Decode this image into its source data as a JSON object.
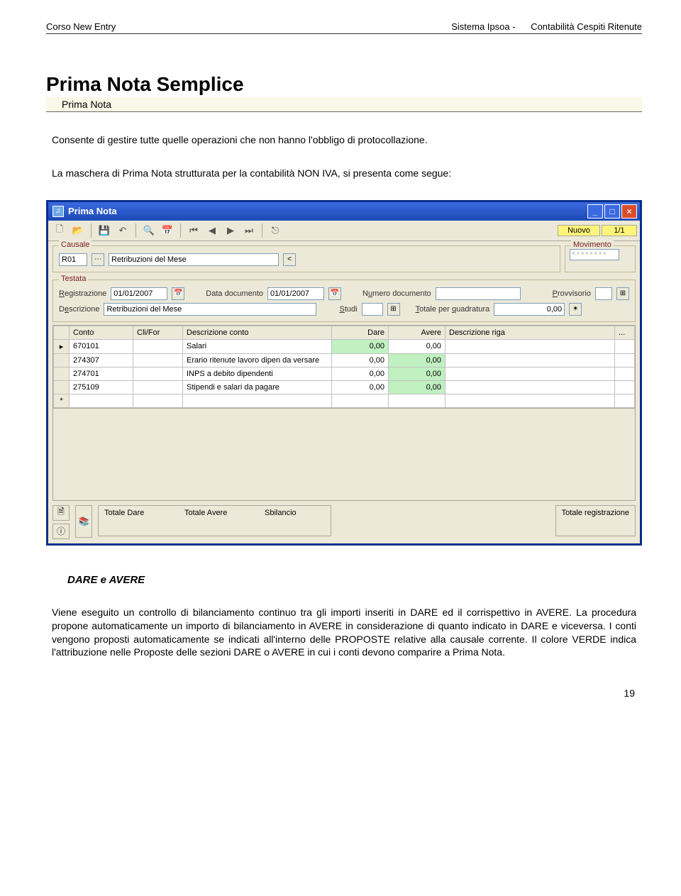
{
  "header": {
    "left": "Corso New Entry",
    "right_a": "Sistema Ipsoa -",
    "right_b": "Contabilità Cespiti Ritenute"
  },
  "title": "Prima Nota Semplice",
  "subtitle": "Prima Nota",
  "intro": "Consente di gestire tutte quelle operazioni che non hanno l'obbligo di protocollazione.",
  "lead_in": "La maschera di Prima Nota strutturata per la contabilità NON IVA, si presenta come segue:",
  "window": {
    "title": "Prima Nota",
    "status_new": "Nuovo",
    "status_count": "1/1",
    "causale": {
      "group": "Causale",
      "code": "R01",
      "desc": "Retribuzioni del Mese"
    },
    "movimento": {
      "group": "Movimento",
      "mask": "××××××××"
    },
    "testata": {
      "group": "Testata",
      "reg_label": "Registrazione",
      "reg_value": "01/01/2007",
      "doc_label": "Data documento",
      "doc_value": "01/01/2007",
      "num_label": "Numero documento",
      "num_value": "",
      "prov_label": "Provvisorio",
      "desc_label": "Descrizione",
      "desc_value": "Retribuzioni del Mese",
      "studi_label": "Studi",
      "tot_label": "Totale per quadratura",
      "tot_value": "0,00"
    },
    "grid": {
      "headers": {
        "conto": "Conto",
        "clifor": "Cli/For",
        "descr": "Descrizione conto",
        "dare": "Dare",
        "avere": "Avere",
        "riga": "Descrizione riga",
        "dots": "..."
      },
      "rows": [
        {
          "conto": "670101",
          "clifor": "",
          "descr": "Salari",
          "dare": "0,00",
          "avere": "0,00",
          "dare_green": true,
          "avere_green": false
        },
        {
          "conto": "274307",
          "clifor": "",
          "descr": "Erario ritenute lavoro dipen da versare",
          "dare": "0,00",
          "avere": "0,00",
          "dare_green": false,
          "avere_green": true
        },
        {
          "conto": "274701",
          "clifor": "",
          "descr": "INPS a debito dipendenti",
          "dare": "0,00",
          "avere": "0,00",
          "dare_green": false,
          "avere_green": true
        },
        {
          "conto": "275109",
          "clifor": "",
          "descr": "Stipendi e salari da pagare",
          "dare": "0,00",
          "avere": "0,00",
          "dare_green": false,
          "avere_green": true
        }
      ]
    },
    "footer": {
      "t_dare": "Totale Dare",
      "t_avere": "Totale Avere",
      "sbilancio": "Sbilancio",
      "t_reg": "Totale registrazione"
    }
  },
  "section_heading": "DARE e AVERE",
  "body_text": "Viene eseguito un controllo di bilanciamento continuo tra gli importi inseriti in DARE ed il corrispettivo in AVERE. La procedura propone automaticamente un importo di bilanciamento in AVERE in considerazione di quanto indicato in DARE e viceversa. I conti vengono proposti automaticamente se indicati all'interno delle PROPOSTE relative alla causale corrente. Il colore VERDE indica l'attribuzione nelle Proposte delle sezioni DARE o AVERE in cui i conti devono comparire a Prima Nota.",
  "page_number": "19"
}
